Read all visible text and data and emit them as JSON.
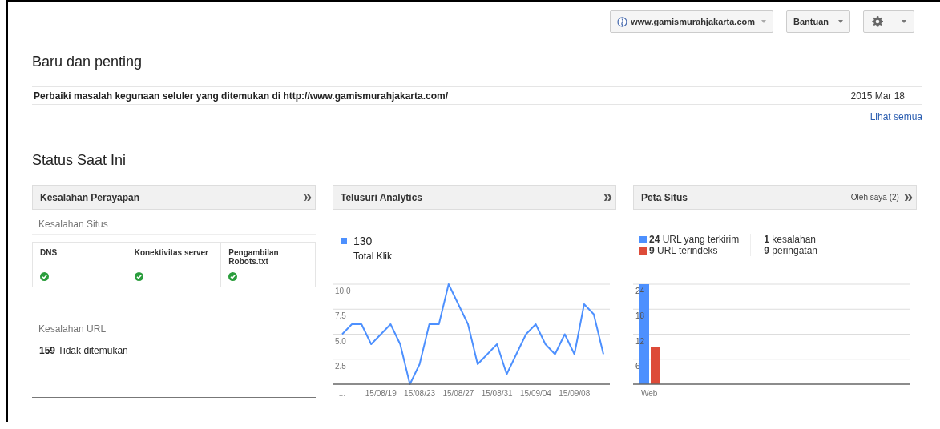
{
  "topbar": {
    "site": "www.gamismurahjakarta.com",
    "help": "Bantuan"
  },
  "news": {
    "title": "Baru dan penting",
    "items": [
      {
        "text": "Perbaiki masalah kegunaan seluler yang ditemukan di http://www.gamismurahjakarta.com/",
        "date": "2015 Mar 18"
      }
    ],
    "see_all": "Lihat semua"
  },
  "status": {
    "title": "Status Saat Ini",
    "crawl": {
      "title": "Kesalahan Perayapan",
      "expand": "»",
      "site_errors_label": "Kesalahan Situs",
      "checks": [
        {
          "label": "DNS",
          "ok": true
        },
        {
          "label": "Konektivitas server",
          "ok": true
        },
        {
          "label": "Pengambilan Robots.txt",
          "ok": true
        }
      ],
      "url_errors_label": "Kesalahan URL",
      "url_errors": [
        {
          "count": "159",
          "label": "Tidak ditemukan"
        }
      ]
    },
    "analytics": {
      "title": "Telusuri Analytics",
      "expand": "»",
      "total": "130",
      "chart_data": {
        "type": "line",
        "categories": [
          "...",
          null,
          null,
          null,
          "15/08/19",
          null,
          null,
          null,
          "15/08/23",
          null,
          null,
          null,
          "15/08/27",
          null,
          null,
          null,
          "15/08/31",
          null,
          null,
          null,
          "15/09/04",
          null,
          null,
          null,
          "15/09/08",
          null,
          null,
          null
        ],
        "series": [
          {
            "name": "Total Klik",
            "color": "#4d90fe",
            "values": [
              5,
              6,
              6,
              4,
              5,
              6,
              4,
              0,
              2,
              6,
              6,
              10,
              8,
              6,
              2,
              3,
              4,
              1,
              3,
              5,
              6,
              4,
              3,
              5,
              3,
              8,
              7,
              3
            ]
          }
        ],
        "ylim": [
          0,
          10
        ],
        "yticks": [
          {
            "value": 2.5,
            "label": "2.5"
          },
          {
            "value": 5,
            "label": "5.0"
          },
          {
            "value": 7.5,
            "label": "7.5"
          },
          {
            "value": 10,
            "label": "10.0"
          }
        ],
        "grid": true
      }
    },
    "sitemaps": {
      "title": "Peta Situs",
      "filter": "Oleh saya (2)",
      "expand": "»",
      "legend_counts": [
        "24",
        "9"
      ],
      "issues": [
        {
          "count": "1",
          "label": "kesalahan"
        },
        {
          "count": "9",
          "label": "peringatan"
        }
      ],
      "chart_data": {
        "type": "bar",
        "categories": [
          "Web"
        ],
        "series": [
          {
            "name": "URL yang terkirim",
            "color": "#4d90fe",
            "values": [
              24
            ]
          },
          {
            "name": "URL terindeks",
            "color": "#dd4b39",
            "values": [
              9
            ]
          }
        ],
        "ylim": [
          0,
          24
        ],
        "yticks": [
          6,
          12,
          18,
          24
        ],
        "grid": true
      }
    }
  }
}
